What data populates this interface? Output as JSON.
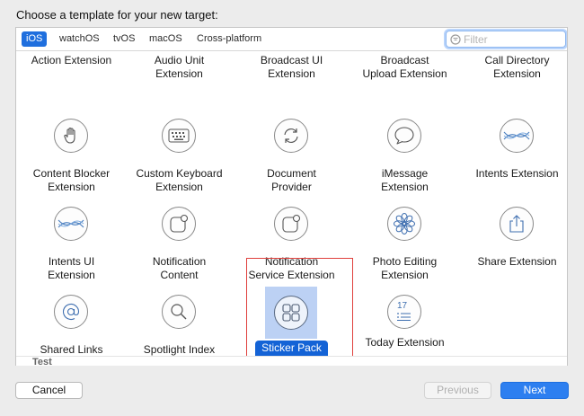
{
  "title": "Choose a template for your new target:",
  "tabs": [
    {
      "label": "iOS",
      "active": true
    },
    {
      "label": "watchOS"
    },
    {
      "label": "tvOS"
    },
    {
      "label": "macOS"
    },
    {
      "label": "Cross-platform"
    }
  ],
  "search": {
    "placeholder": "Filter",
    "value": ""
  },
  "row0": [
    {
      "label": "Action Extension"
    },
    {
      "label": "Audio Unit\nExtension",
      "icon": "keyboard-icon"
    },
    {
      "label": "Broadcast UI\nExtension",
      "icon": "refresh-icon"
    },
    {
      "label": "Broadcast\nUpload Extension",
      "icon": "speech-bubble-icon"
    },
    {
      "label": "Call Directory\nExtension",
      "icon": "intents-wave-icon"
    }
  ],
  "row1": [
    {
      "label": "Content Blocker\nExtension",
      "icon": "hand-icon"
    },
    {
      "label": "Custom Keyboard\nExtension",
      "icon": "keyboard-icon"
    },
    {
      "label": "Document\nProvider",
      "icon": "refresh-icon"
    },
    {
      "label": "iMessage\nExtension",
      "icon": "speech-bubble-icon"
    },
    {
      "label": "Intents Extension",
      "icon": "intents-wave-icon"
    }
  ],
  "row2": [
    {
      "label": "Intents UI\nExtension",
      "icon": "intents-wave-icon"
    },
    {
      "label": "Notification\nContent",
      "icon": "notification-icon"
    },
    {
      "label": "Notification\nService Extension",
      "icon": "notification-icon"
    },
    {
      "label": "Photo Editing\nExtension",
      "icon": "flower-icon"
    },
    {
      "label": "Share Extension",
      "icon": "share-icon"
    }
  ],
  "row3": [
    {
      "label": "Shared Links\nExtension",
      "icon": "at-sign-icon"
    },
    {
      "label": "Spotlight Index\nExtension",
      "icon": "magnifier-icon"
    },
    {
      "label": "Sticker Pack\nExtension",
      "icon": "sticker-grid-icon",
      "selected": true
    },
    {
      "label": "Today Extension",
      "icon": "today-calendar-icon",
      "day": "17"
    }
  ],
  "section": "Test",
  "buttons": {
    "cancel": "Cancel",
    "previous": "Previous",
    "next": "Next"
  },
  "colors": {
    "accent": "#2d7ff0",
    "selection": "#1463d6",
    "highlight": "#e0403c"
  }
}
